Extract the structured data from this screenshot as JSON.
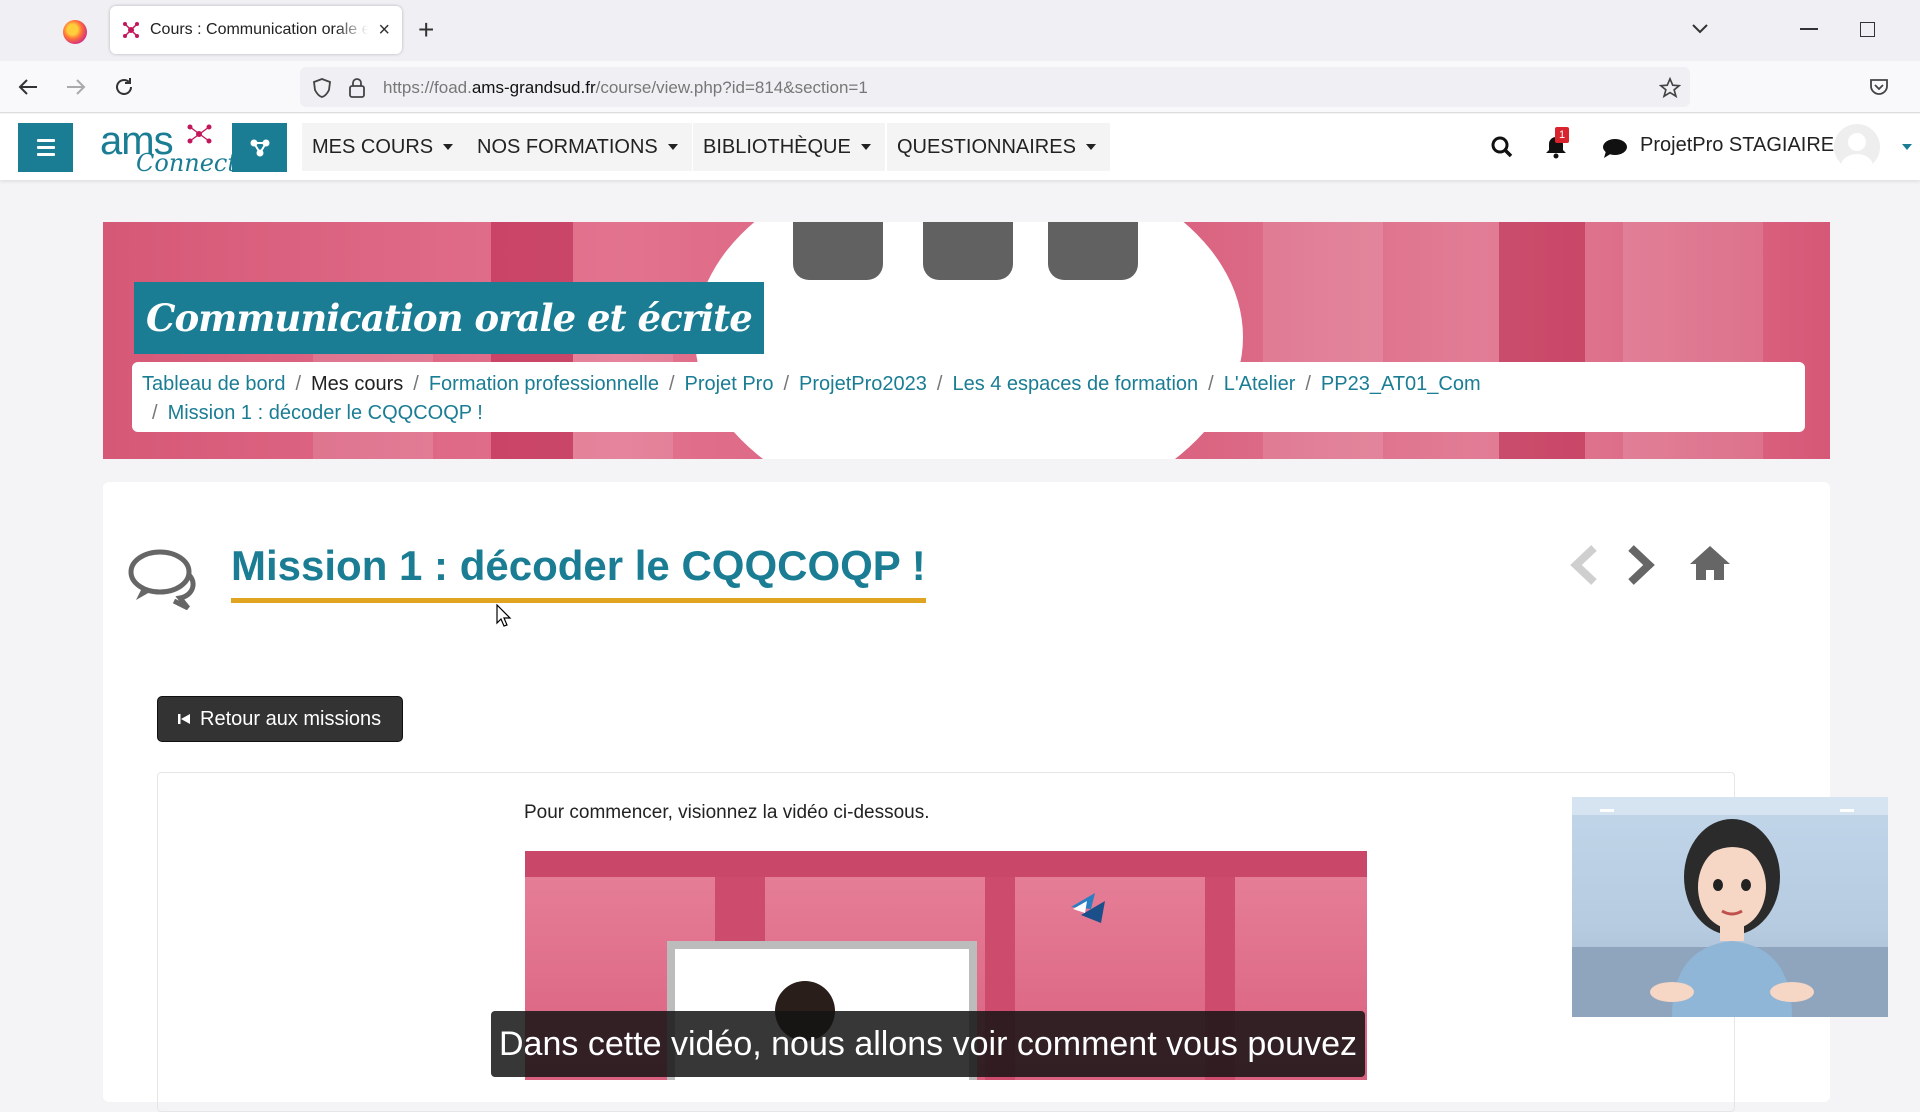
{
  "browser": {
    "tab_title": "Cours : Communication orale et écrite",
    "url_prefix": "https://foad.",
    "url_domain": "ams-grandsud.fr",
    "url_path": "/course/view.php?id=814&section=1"
  },
  "header": {
    "logo_main": "ams",
    "logo_sub": "Connect",
    "menus": [
      "MES COURS",
      "NOS FORMATIONS",
      "BIBLIOTHÈQUE",
      "QUESTIONNAIRES"
    ],
    "notification_count": "1",
    "username": "ProjetPro STAGIAIRE"
  },
  "banner": {
    "course_title": "Communication orale et écrite"
  },
  "breadcrumb": [
    "Tableau de bord",
    "Mes cours",
    "Formation professionnelle",
    "Projet Pro",
    "ProjetPro2023",
    "Les 4 espaces de formation",
    "L'Atelier",
    "PP23_AT01_Com",
    "Mission 1 : décoder le CQQCOQP !"
  ],
  "page": {
    "title": "Mission 1 : décoder le CQQCOQP !",
    "back_button": "Retour aux missions",
    "intro_text": "Pour commencer, visionnez la vidéo ci-dessous."
  },
  "video": {
    "caption": "Dans cette vidéo, nous allons voir comment vous pouvez"
  },
  "colors": {
    "accent": "#1a7d94",
    "title_underline": "#e0a420",
    "banner_pink": "#d65877"
  }
}
